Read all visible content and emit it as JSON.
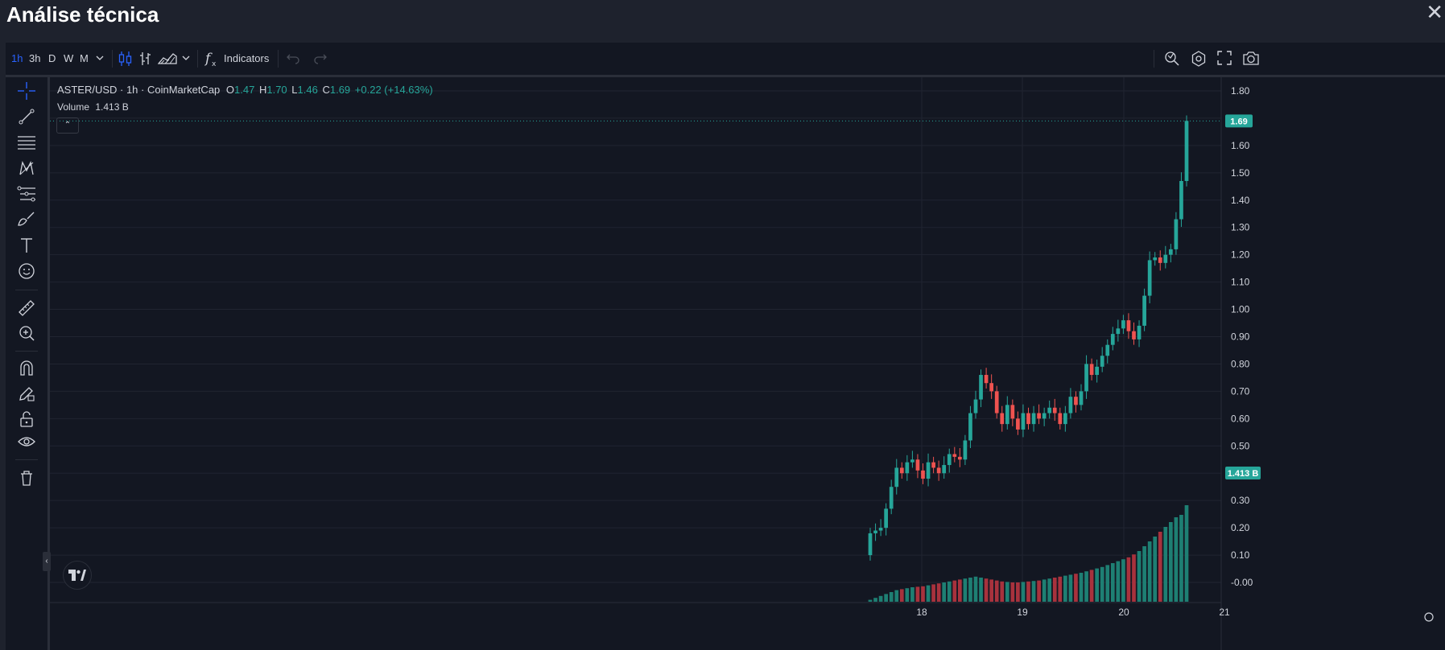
{
  "window": {
    "title": "Análise técnica",
    "close_glyph": "✕"
  },
  "toolbar": {
    "intervals": [
      "1h",
      "3h",
      "D",
      "W",
      "M"
    ],
    "active_interval": "1h",
    "indicators_label": "Indicators"
  },
  "legend": {
    "symbol": "ASTER/USD · 1h · CoinMarketCap",
    "o_label": "O",
    "o_value": "1.47",
    "h_label": "H",
    "h_value": "1.70",
    "l_label": "L",
    "l_value": "1.46",
    "c_label": "C",
    "c_value": "1.69",
    "change": "+0.22 (+14.63%)",
    "volume_label": "Volume",
    "volume_value": "1.413 B"
  },
  "colors": {
    "up": "#26a69a",
    "down": "#ef5350",
    "vol_up": "#1e7f73",
    "vol_down": "#a8323d",
    "background": "#131722",
    "grid": "#202431"
  },
  "left_tools": [
    "crosshair-icon",
    "trend-line-icon",
    "horizontal-lines-icon",
    "pattern-icon",
    "fib-icon",
    "brush-icon",
    "text-icon",
    "emoji-icon",
    "ruler-icon",
    "zoom-in-icon",
    "magnet-icon",
    "lock-pencil-icon",
    "lock-icon",
    "eye-icon",
    "trash-icon"
  ],
  "chart_data": {
    "type": "candlestick",
    "price_axis_labels": [
      "1.80",
      "1.70",
      "1.60",
      "1.50",
      "1.40",
      "1.30",
      "1.20",
      "1.10",
      "1.00",
      "0.90",
      "0.80",
      "0.70",
      "0.60",
      "0.50",
      "0.40",
      "0.30",
      "0.20",
      "0.10",
      "-0.00"
    ],
    "y_range": [
      -0.05,
      1.85
    ],
    "x_labels": [
      "18",
      "19",
      "20",
      "21"
    ],
    "last_price_label": "1.69",
    "volume_label": "1.413 B",
    "closes": [
      0.18,
      0.19,
      0.2,
      0.27,
      0.35,
      0.42,
      0.4,
      0.44,
      0.45,
      0.41,
      0.38,
      0.44,
      0.42,
      0.4,
      0.43,
      0.47,
      0.46,
      0.45,
      0.52,
      0.62,
      0.67,
      0.76,
      0.73,
      0.7,
      0.62,
      0.58,
      0.65,
      0.6,
      0.56,
      0.62,
      0.58,
      0.62,
      0.6,
      0.62,
      0.64,
      0.62,
      0.58,
      0.62,
      0.68,
      0.65,
      0.7,
      0.8,
      0.76,
      0.79,
      0.83,
      0.87,
      0.91,
      0.93,
      0.96,
      0.92,
      0.89,
      0.94,
      1.05,
      1.18,
      1.19,
      1.17,
      1.2,
      1.22,
      1.33,
      1.47,
      1.69
    ],
    "volumes": [
      0.004,
      0.008,
      0.012,
      0.016,
      0.02,
      0.024,
      0.026,
      0.028,
      0.03,
      0.031,
      0.032,
      0.034,
      0.036,
      0.038,
      0.04,
      0.042,
      0.044,
      0.046,
      0.048,
      0.05,
      0.052,
      0.05,
      0.048,
      0.046,
      0.044,
      0.042,
      0.041,
      0.04,
      0.04,
      0.041,
      0.042,
      0.043,
      0.044,
      0.046,
      0.048,
      0.05,
      0.052,
      0.054,
      0.056,
      0.058,
      0.06,
      0.063,
      0.066,
      0.069,
      0.072,
      0.076,
      0.08,
      0.084,
      0.088,
      0.092,
      0.098,
      0.105,
      0.115,
      0.125,
      0.135,
      0.145,
      0.155,
      0.165,
      0.175,
      0.18,
      0.2
    ]
  }
}
